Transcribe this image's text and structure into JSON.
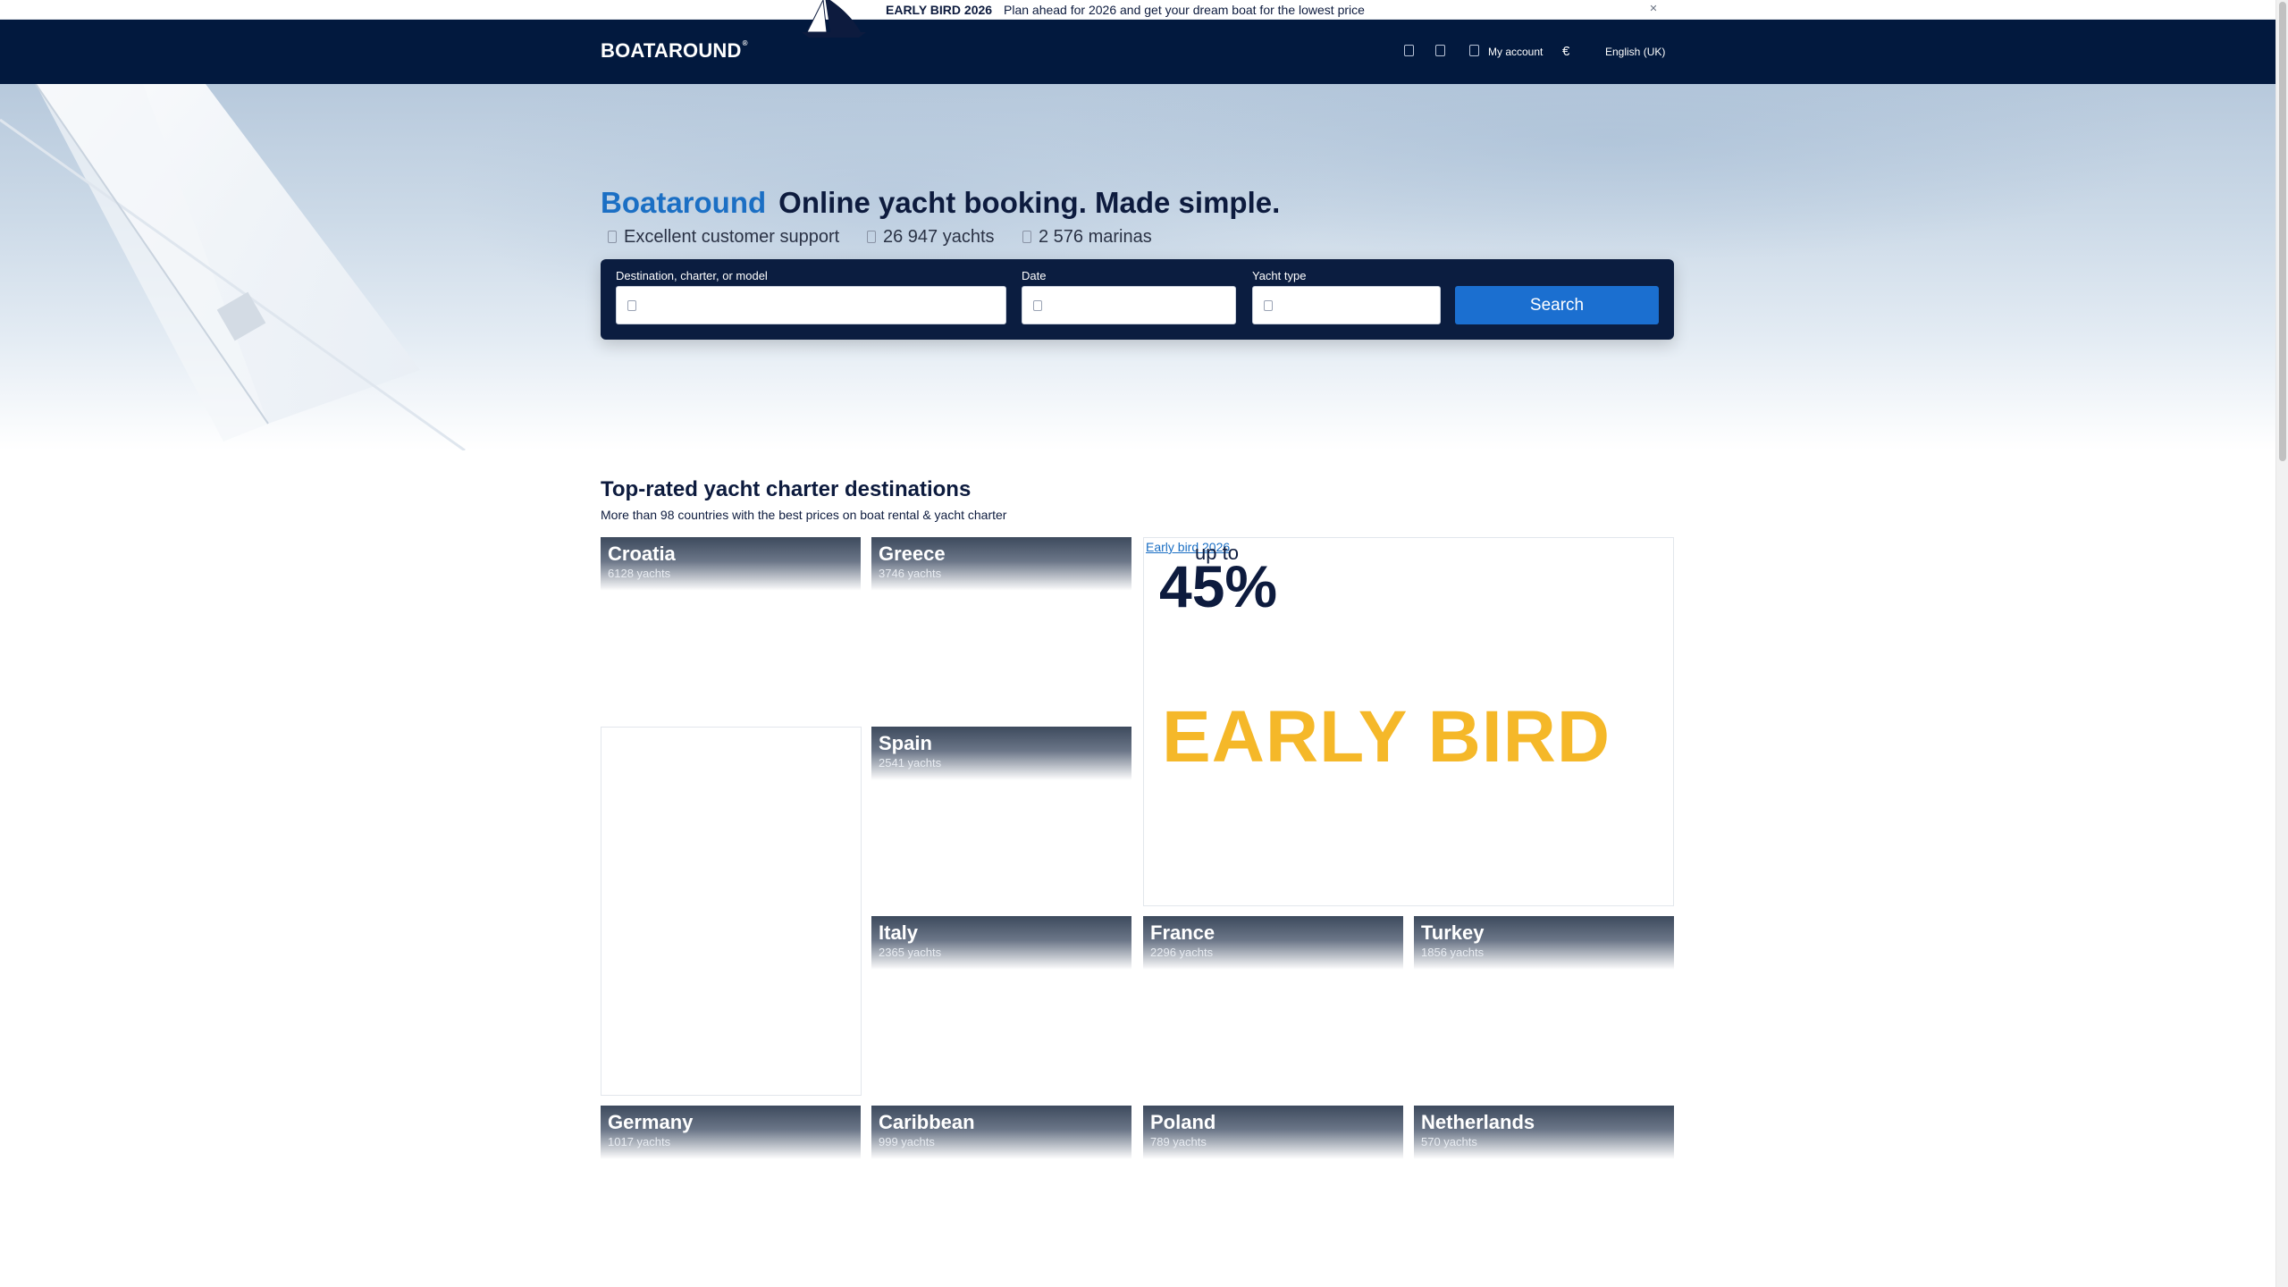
{
  "promo_bar": {
    "title": "EARLY BIRD 2026",
    "text": "Plan ahead for 2026 and get your dream boat for the lowest price"
  },
  "header": {
    "logo": "BOATAROUND",
    "my_account": "My account",
    "currency": "€",
    "language": "English (UK)"
  },
  "hero": {
    "brand": "Boataround",
    "headline": "Online yacht booking. Made simple.",
    "stats": [
      "Excellent customer support",
      "26 947 yachts",
      "2 576 marinas"
    ]
  },
  "search": {
    "destination_label": "Destination, charter, or model",
    "date_label": "Date",
    "yacht_type_label": "Yacht type",
    "button": "Search"
  },
  "destinations": {
    "title": "Top-rated yacht charter destinations",
    "subtitle": "More than 98 countries with the best prices on boat rental & yacht charter",
    "items": [
      {
        "name": "Croatia",
        "count": "6128 yachts"
      },
      {
        "name": "Greece",
        "count": "3746 yachts"
      },
      {
        "name": "Spain",
        "count": "2541 yachts"
      },
      {
        "name": "Italy",
        "count": "2365 yachts"
      },
      {
        "name": "France",
        "count": "2296 yachts"
      },
      {
        "name": "Turkey",
        "count": "1856 yachts"
      },
      {
        "name": "Germany",
        "count": "1017 yachts"
      },
      {
        "name": "Caribbean",
        "count": "999 yachts"
      },
      {
        "name": "Poland",
        "count": "789 yachts"
      },
      {
        "name": "Netherlands",
        "count": "570 yachts"
      }
    ]
  },
  "promo_card": {
    "image_alt": "Early bird 2026",
    "up_to": "up to",
    "percent": "45%",
    "label": "EARLY BIRD"
  },
  "colors": {
    "navy": "#02193e",
    "brand_blue": "#1b6fc4",
    "button_blue": "#1b6fd0",
    "early_bird_yellow": "#f5b829"
  }
}
